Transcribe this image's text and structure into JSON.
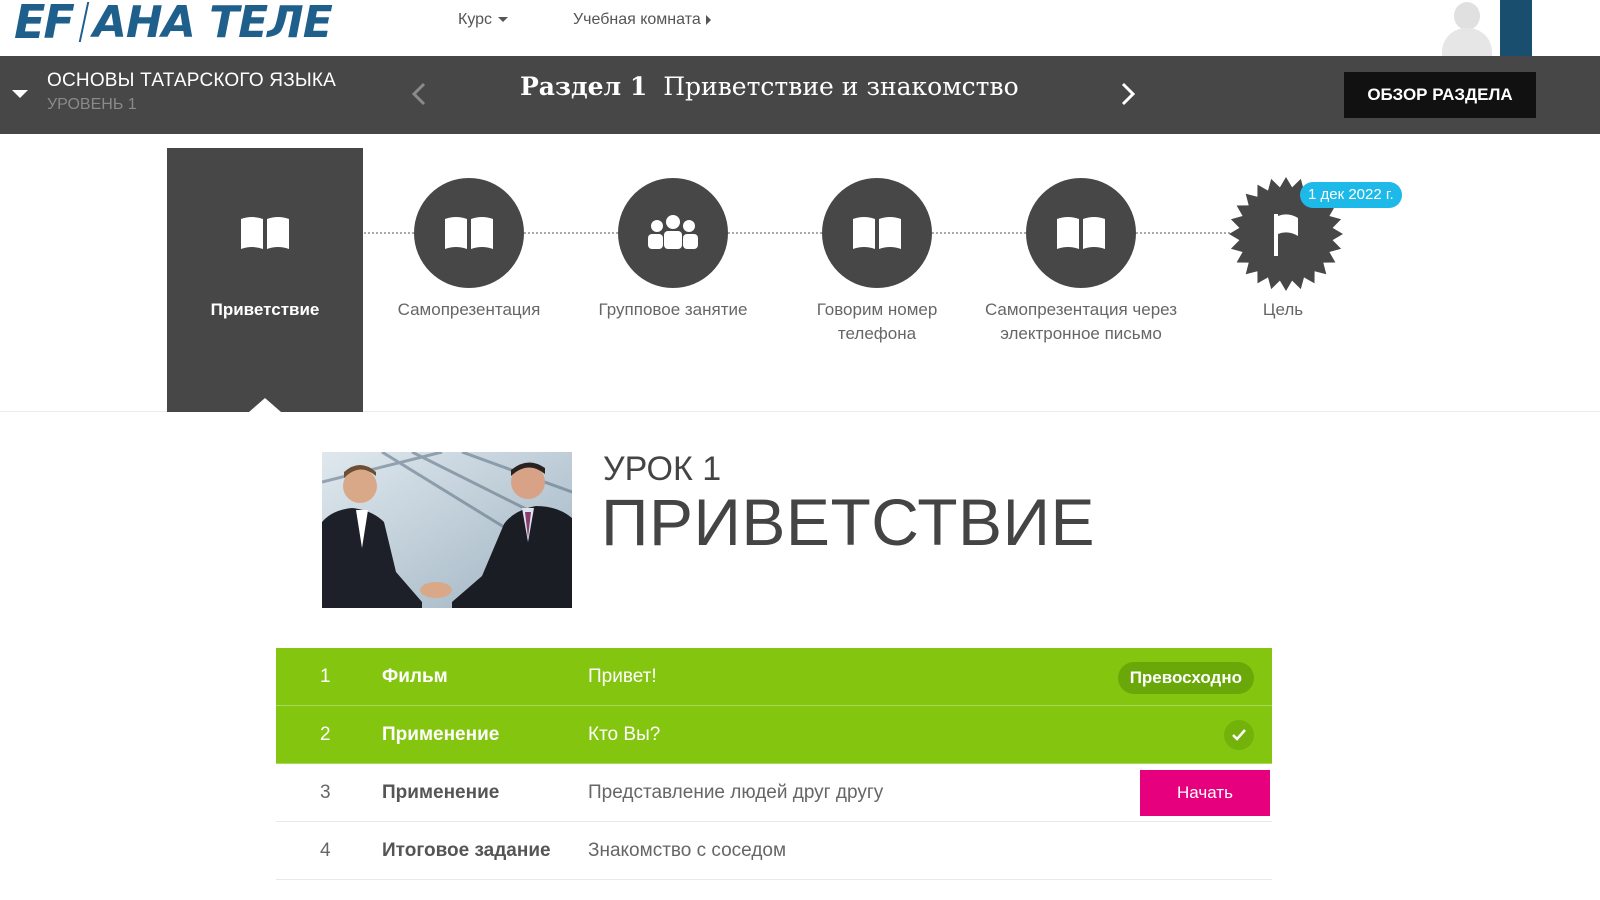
{
  "header": {
    "logo_ef": "EF",
    "logo_name": "АНА ТЕЛЕ",
    "nav_course": "Курс",
    "nav_classroom": "Учебная комната"
  },
  "unit_bar": {
    "course_title": "ОСНОВЫ ТАТАРСКОГО ЯЗЫКА",
    "course_level": "УРОВЕНЬ 1",
    "unit_label": "Раздел 1",
    "unit_title": "Приветствие и знакомство",
    "overview_button": "ОБЗОР РАЗДЕЛА"
  },
  "steps": [
    {
      "label": "Приветствие",
      "icon": "book-icon",
      "active": true
    },
    {
      "label": "Самопрезентация",
      "icon": "book-icon",
      "active": false
    },
    {
      "label": "Групповое занятие",
      "icon": "group-icon",
      "active": false
    },
    {
      "label": "Говорим номер телефона",
      "icon": "book-icon",
      "active": false
    },
    {
      "label": "Самопрезентация через электронное письмо",
      "icon": "book-icon",
      "active": false
    },
    {
      "label": "Цель",
      "icon": "flag-icon",
      "active": false
    }
  ],
  "goal_date": "1 дек 2022 г.",
  "lesson": {
    "kicker": "УРОК 1",
    "title": "ПРИВЕТСТВИЕ"
  },
  "activities": [
    {
      "num": "1",
      "type": "Фильм",
      "name": "Привет!",
      "status": "done",
      "badge": "Превосходно"
    },
    {
      "num": "2",
      "type": "Применение",
      "name": "Кто Вы?",
      "status": "done",
      "badge": ""
    },
    {
      "num": "3",
      "type": "Применение",
      "name": "Представление людей друг другу",
      "status": "current",
      "badge": ""
    },
    {
      "num": "4",
      "type": "Итоговое задание",
      "name": "Знакомство с соседом",
      "status": "todo",
      "badge": ""
    }
  ],
  "start_button": "Начать",
  "colors": {
    "brand_blue": "#1f5f8c",
    "bar_gray": "#474747",
    "done_green": "#84c60f",
    "start_pink": "#e6007e",
    "date_badge": "#1db9e8"
  }
}
